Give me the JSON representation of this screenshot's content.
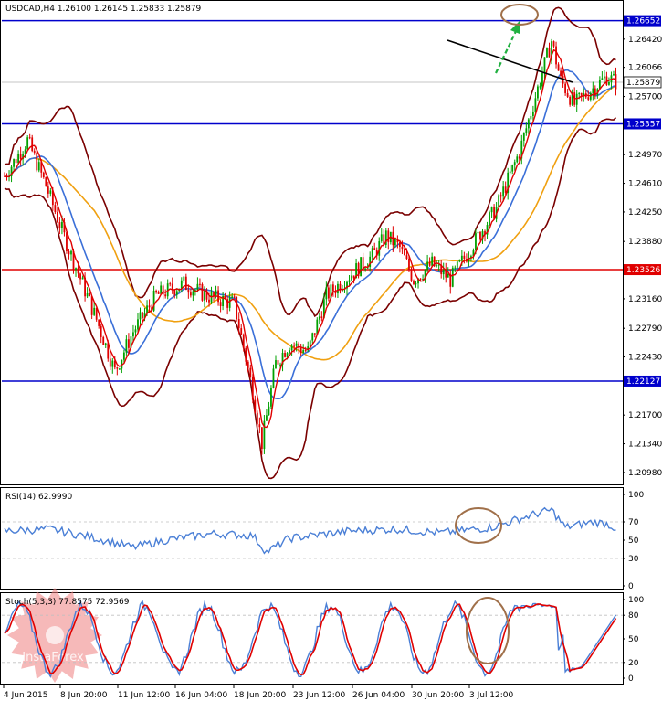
{
  "chart_data": [
    {
      "type": "candlestick",
      "panel": "price",
      "header": "USDCAD,H4  1.26100 1.26145 1.25833 1.25879",
      "symbol": "USDCAD",
      "timeframe": "H4",
      "ohlc_last": [
        1.261,
        1.26145,
        1.25833,
        1.25879
      ],
      "ylim": [
        1.2083,
        1.269
      ],
      "y_ticks": [
        "1.26420",
        "1.26066",
        "1.25700",
        "1.24970",
        "1.24610",
        "1.24250",
        "1.23880",
        "1.23160",
        "1.22790",
        "1.22430",
        "1.21700",
        "1.21340",
        "1.20980"
      ],
      "x_ticks": [
        "4 Jun 2015",
        "8 Jun 20:00",
        "11 Jun 12:00",
        "16 Jun 04:00",
        "18 Jun 20:00",
        "23 Jun 12:00",
        "26 Jun 04:00",
        "30 Jun 20:00",
        "3 Jul 12:00"
      ],
      "current_price": {
        "label": "1.25879",
        "value": 1.25879
      },
      "levels": [
        {
          "label": "1.26652",
          "value": 1.26652,
          "color": "#0000cc"
        },
        {
          "label": "1.25357",
          "value": 1.25357,
          "color": "#0000cc"
        },
        {
          "label": "1.23526",
          "value": 1.23526,
          "color": "#e00000"
        },
        {
          "label": "1.22127",
          "value": 1.22127,
          "color": "#0000cc"
        }
      ],
      "overlays": [
        "Bollinger Bands (dark red)",
        "fast moving average (red)",
        "moving average (blue)",
        "slow moving average (orange)"
      ],
      "annotations": [
        "trend line (black)",
        "green arrow up",
        "brown ellipse at target"
      ]
    },
    {
      "type": "line",
      "panel": "rsi",
      "header": "RSI(14) 62.9990",
      "value": 62.999,
      "ylim": [
        0,
        100
      ],
      "y_ticks": [
        "100",
        "70",
        "50",
        "30",
        "0"
      ],
      "color": "#4a7fd6"
    },
    {
      "type": "line",
      "panel": "stochastic",
      "header": "Stoch(5,3,3) 77.8575 72.9569",
      "main": 77.8575,
      "signal": 72.9569,
      "ylim": [
        0,
        100
      ],
      "y_ticks": [
        "100",
        "80",
        "50",
        "20",
        "0"
      ],
      "colors": {
        "main": "#4a7fd6",
        "signal": "#e00000"
      }
    }
  ],
  "watermark": {
    "text": "InstaForex"
  },
  "colors": {
    "bull": "#00a000",
    "bear": "#e00000",
    "bb": "#7a0000",
    "ma_fast": "#e00000",
    "ma_mid": "#3a6fd8",
    "ma_slow": "#f0a010",
    "ellipse": "#a0704a",
    "arrow": "#20b040"
  }
}
